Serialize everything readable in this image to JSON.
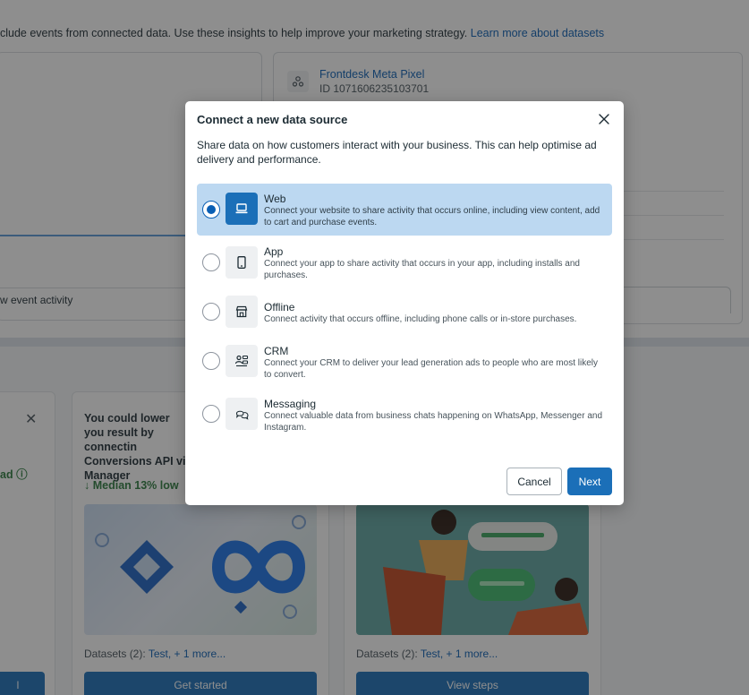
{
  "background": {
    "description": "clude events from connected data. Use these insights to help improve your marketing strategy.",
    "description_link": "Learn more about datasets",
    "pixel_name": "Frontdesk Meta Pixel",
    "pixel_id": "ID 1071606235103701",
    "event_activity_label": "w event activity",
    "card1_tag": "ad",
    "card2_title": "You could lower you result by connectin Conversions API vi Manager",
    "card2_median": "↓ Median 13% low",
    "datasets_label": "Datasets (2):",
    "datasets_link": "Test, + 1 more...",
    "card1_button": "l",
    "card2_button": "Get started",
    "card3_button": "View steps"
  },
  "modal": {
    "title": "Connect a new data source",
    "description": "Share data on how customers interact with your business. This can help optimise ad delivery and performance.",
    "options": [
      {
        "name": "Web",
        "description": "Connect your website to share activity that occurs online, including view content, add to cart and purchase events.",
        "icon": "laptop-icon",
        "selected": true
      },
      {
        "name": "App",
        "description": "Connect your app to share activity that occurs in your app, including installs and purchases.",
        "icon": "mobile-icon",
        "selected": false
      },
      {
        "name": "Offline",
        "description": "Connect activity that occurs offline, including phone calls or in-store purchases.",
        "icon": "store-icon",
        "selected": false
      },
      {
        "name": "CRM",
        "description": "Connect your CRM to deliver your lead generation ads to people who are most likely to convert.",
        "icon": "crm-icon",
        "selected": false
      },
      {
        "name": "Messaging",
        "description": "Connect valuable data from business chats happening on WhatsApp, Messenger and Instagram.",
        "icon": "chat-icon",
        "selected": false
      }
    ],
    "cancel_label": "Cancel",
    "next_label": "Next"
  },
  "colors": {
    "primary": "#1b6fb8",
    "selected_bg": "#bcd8f1",
    "link": "#0a5fb4",
    "success": "#2b7a3d"
  }
}
